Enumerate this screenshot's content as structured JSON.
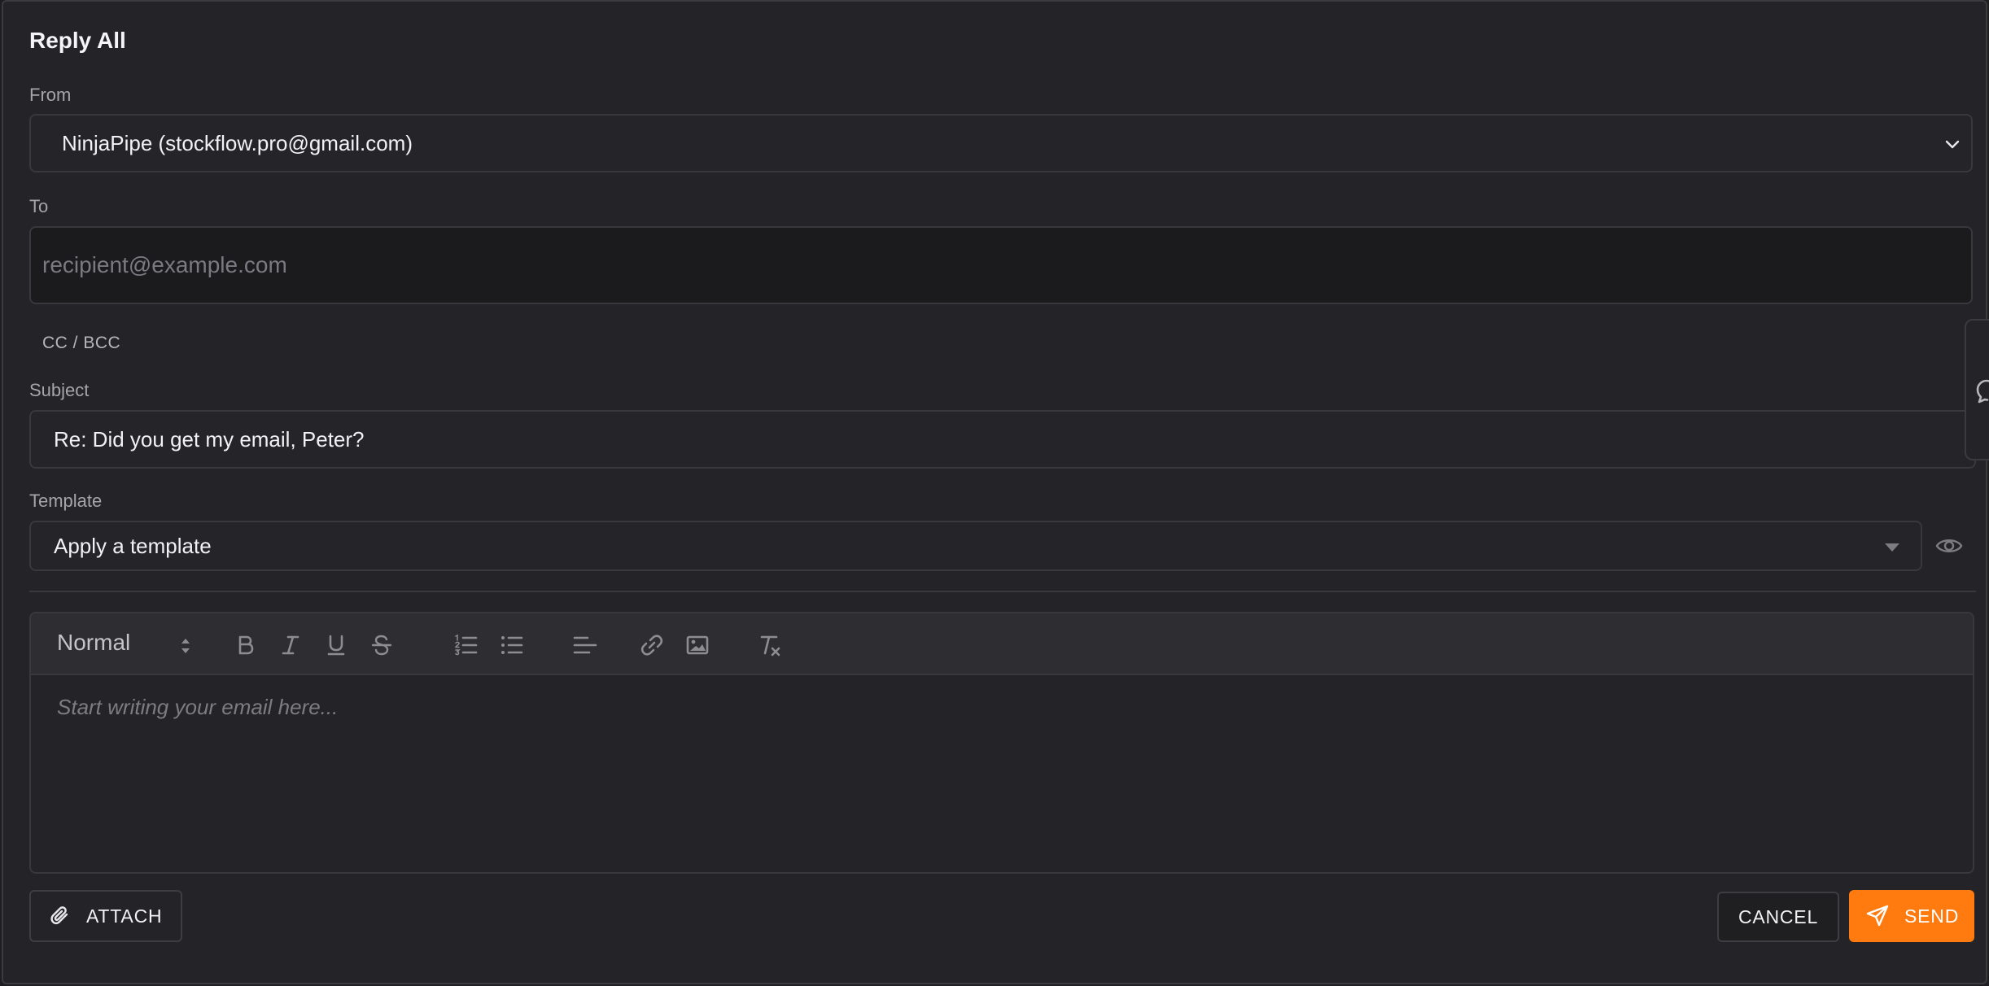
{
  "dialog": {
    "title": "Reply All"
  },
  "from": {
    "label": "From",
    "value": "NinjaPipe (stockflow.pro@gmail.com)"
  },
  "to": {
    "label": "To",
    "placeholder": "recipient@example.com",
    "value": ""
  },
  "cc_bcc": {
    "label": "CC / BCC"
  },
  "subject": {
    "label": "Subject",
    "value": "Re: Did you get my email, Peter?"
  },
  "template": {
    "label": "Template",
    "value": "Apply a template"
  },
  "editor": {
    "format": "Normal",
    "placeholder": "Start writing your email here...",
    "toolbar_icons": [
      "bold-icon",
      "italic-icon",
      "underline-icon",
      "strikethrough-icon",
      "ordered-list-icon",
      "bullet-list-icon",
      "align-left-icon",
      "link-icon",
      "image-icon",
      "clear-format-icon"
    ]
  },
  "actions": {
    "attach": "ATTACH",
    "cancel": "CANCEL",
    "send": "SEND"
  },
  "colors": {
    "accent": "#ff7b0f",
    "background": "#242428",
    "border": "#38383d"
  }
}
